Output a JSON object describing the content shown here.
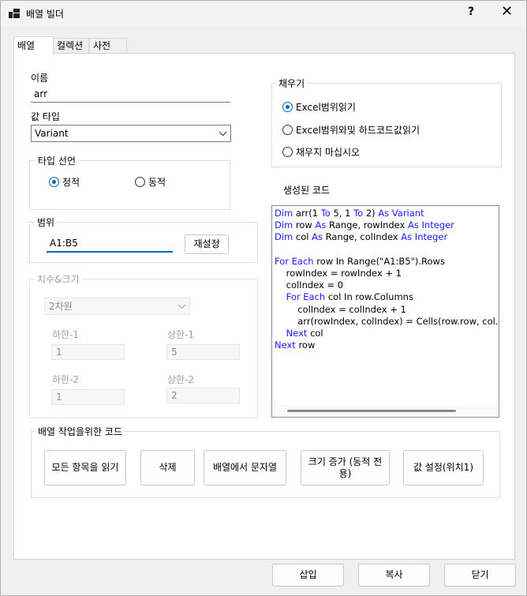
{
  "window": {
    "title": "배열 빌더",
    "help_label": "?",
    "close_label": "✕"
  },
  "tabs": [
    {
      "label": "배열"
    },
    {
      "label": "컬렉션"
    },
    {
      "label": "사전"
    }
  ],
  "name": {
    "label": "이름",
    "value": "arr"
  },
  "value_type": {
    "label": "값 타입",
    "value": "Variant"
  },
  "type_decl": {
    "legend": "타입 선언",
    "options": [
      "정적",
      "동적"
    ],
    "selected": "정적"
  },
  "range": {
    "legend": "범위",
    "value": "A1:B5",
    "reset_label": "재설정"
  },
  "dims": {
    "legend": "치수&크기",
    "select_value": "2차원",
    "lower1_label": "하한-1",
    "lower1_value": "1",
    "upper1_label": "상한-1",
    "upper1_value": "5",
    "lower2_label": "하한-2",
    "lower2_value": "1",
    "upper2_label": "상한-2",
    "upper2_value": "2"
  },
  "fill": {
    "legend": "채우기",
    "options": [
      "Excel범위읽기",
      "Excel범위와및 하드코드값읽기",
      "채우지 마십시오"
    ],
    "selected": "Excel범위읽기"
  },
  "generated": {
    "label": "생성된 코드",
    "lines": [
      [
        [
          "k",
          "Dim"
        ],
        [
          "t",
          " arr(1 "
        ],
        [
          "k",
          "To"
        ],
        [
          "t",
          " 5, 1 "
        ],
        [
          "k",
          "To"
        ],
        [
          "t",
          " 2) "
        ],
        [
          "k",
          "As Variant"
        ]
      ],
      [
        [
          "k",
          "Dim"
        ],
        [
          "t",
          " row "
        ],
        [
          "k",
          "As"
        ],
        [
          "t",
          " Range, rowIndex "
        ],
        [
          "k",
          "As Integer"
        ]
      ],
      [
        [
          "k",
          "Dim"
        ],
        [
          "t",
          " col "
        ],
        [
          "k",
          "As"
        ],
        [
          "t",
          " Range, colIndex "
        ],
        [
          "k",
          "As Integer"
        ]
      ],
      [],
      [
        [
          "k",
          "For Each"
        ],
        [
          "t",
          " row In Range(\"A1:B5\").Rows"
        ]
      ],
      [
        [
          "t",
          "    rowIndex = rowIndex + 1"
        ]
      ],
      [
        [
          "t",
          "    colIndex = 0"
        ]
      ],
      [
        [
          "t",
          "    "
        ],
        [
          "k",
          "For Each"
        ],
        [
          "t",
          " col In row.Columns"
        ]
      ],
      [
        [
          "t",
          "        colIndex = colIndex + 1"
        ]
      ],
      [
        [
          "t",
          "        arr(rowIndex, colIndex) = Cells(row.row, col.Colum"
        ]
      ],
      [
        [
          "t",
          "    "
        ],
        [
          "k",
          "Next"
        ],
        [
          "t",
          " col"
        ]
      ],
      [
        [
          "k",
          "Next"
        ],
        [
          "t",
          " row"
        ]
      ]
    ]
  },
  "actions": {
    "legend": "배열 작업을위한 코드",
    "read_all": "모든 항목을 읽기",
    "delete": "삭제",
    "to_string": "배열에서 문자열",
    "grow": "크기 증가 (동적 전용)",
    "set_value": "값 설정(위치1)"
  },
  "footer": {
    "insert": "삽입",
    "copy": "복사",
    "close": "닫기"
  },
  "colors": {
    "keyword": "#1a1aff",
    "accent": "#0067c0"
  }
}
